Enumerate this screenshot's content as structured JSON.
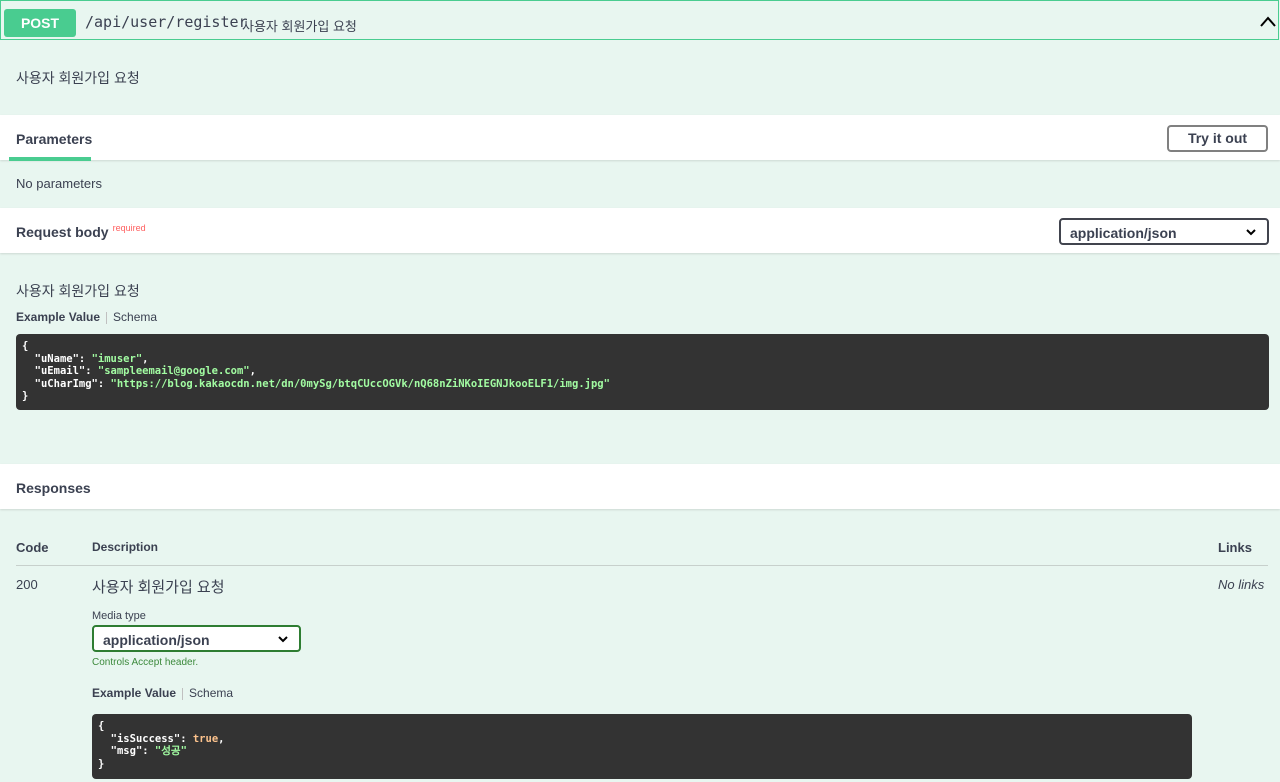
{
  "header": {
    "method": "POST",
    "path": "/api/user/register",
    "summary": "사용자 회원가입 요청"
  },
  "description": "사용자 회원가입 요청",
  "parameters": {
    "title": "Parameters",
    "try_button": "Try it out",
    "empty_text": "No parameters"
  },
  "request_body": {
    "title": "Request body",
    "required": "required",
    "content_type": "application/json",
    "description": "사용자 회원가입 요청",
    "example_tab": "Example Value",
    "schema_tab": "Schema",
    "code": {
      "open": "{",
      "lines": [
        {
          "key": "\"uName\"",
          "value": "\"imuser\"",
          "tail": ","
        },
        {
          "key": "\"uEmail\"",
          "value": "\"sampleemail@google.com\"",
          "tail": ","
        },
        {
          "key": "\"uCharImg\"",
          "value": "\"https://blog.kakaocdn.net/dn/0mySg/btqCUccOGVk/nQ68nZiNKoIEGNJkooELF1/img.jpg\"",
          "tail": ""
        }
      ],
      "close": "}"
    }
  },
  "responses": {
    "title": "Responses",
    "col_code": "Code",
    "col_description": "Description",
    "col_links": "Links",
    "rows": [
      {
        "code": "200",
        "description": "사용자 회원가입 요청",
        "links": "No links",
        "media_type_label": "Media type",
        "media_type": "application/json",
        "controls_text": "Controls Accept header.",
        "example_tab": "Example Value",
        "schema_tab": "Schema",
        "code_block": {
          "open": "{",
          "lines": [
            {
              "key": "\"isSuccess\"",
              "value": "true",
              "tail": ","
            },
            {
              "key": "\"msg\"",
              "value": "\"성공\"",
              "tail": ""
            }
          ],
          "close": "}"
        }
      }
    ]
  },
  "colors": {
    "post_green": "#49cc90",
    "panel_bg": "#e8f6f0",
    "code_bg": "#333333",
    "required_red": "#ff6060"
  }
}
